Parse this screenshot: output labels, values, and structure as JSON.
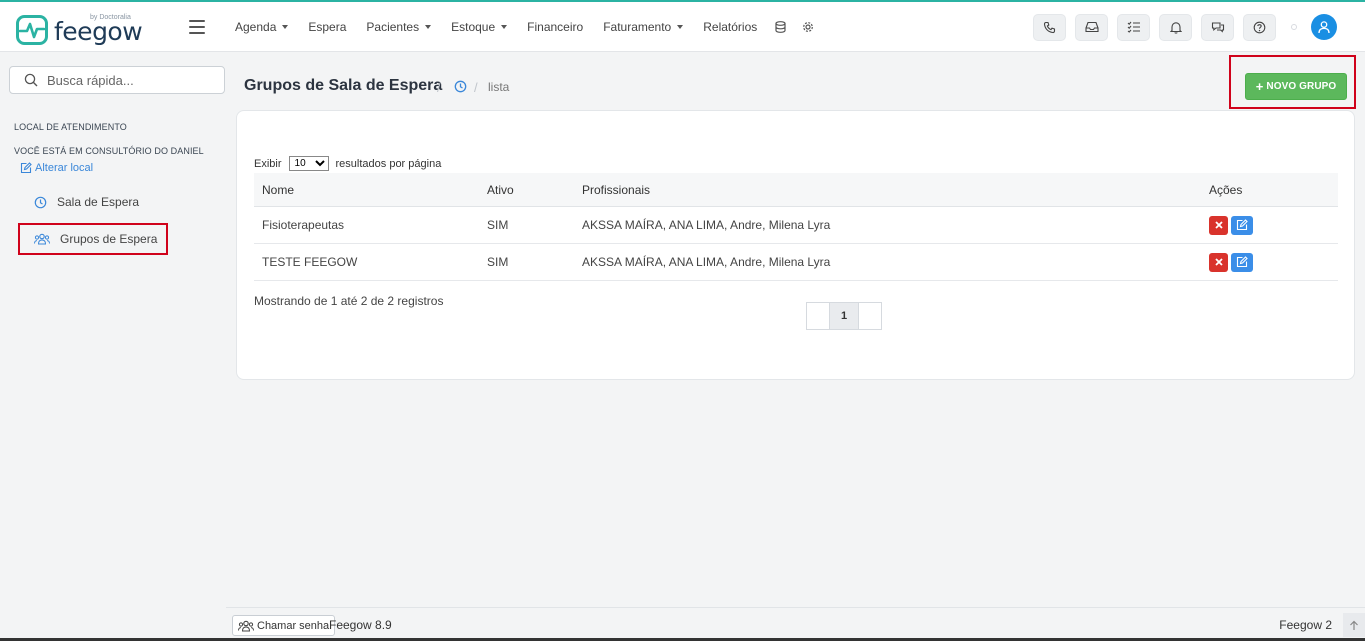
{
  "app": {
    "logo_text": "feegow",
    "logo_sub": "by Doctoralia"
  },
  "nav": {
    "items": [
      {
        "label": "Agenda",
        "dropdown": true
      },
      {
        "label": "Espera",
        "dropdown": false
      },
      {
        "label": "Pacientes",
        "dropdown": true
      },
      {
        "label": "Estoque",
        "dropdown": true
      },
      {
        "label": "Financeiro",
        "dropdown": false
      },
      {
        "label": "Faturamento",
        "dropdown": true
      },
      {
        "label": "Relatórios",
        "dropdown": false
      }
    ],
    "icons": [
      "database-icon",
      "gear-icon"
    ]
  },
  "toolbar": {
    "buttons": [
      "phone-icon",
      "inbox-icon",
      "checklist-icon",
      "bell-icon",
      "chat-icon",
      "help-icon"
    ],
    "avatar_icon": "user-icon",
    "avatar_color": "#1a8fe3"
  },
  "sidebar": {
    "search_placeholder": "Busca rápida...",
    "location_header": "LOCAL DE ATENDIMENTO",
    "location_current": "VOCÊ ESTÁ EM CONSULTÓRIO DO DANIEL",
    "change_location": "Alterar local",
    "items": [
      {
        "label": "Sala de Espera",
        "icon": "clock-icon",
        "active": false
      },
      {
        "label": "Grupos de Espera",
        "icon": "users-icon",
        "active": true
      }
    ]
  },
  "page": {
    "title": "Grupos de Sala de Espera",
    "breadcrumb_icon": "clock-icon",
    "breadcrumb": "lista",
    "new_button": "NOVO GRUPO",
    "new_button_color": "#5cb85c"
  },
  "table": {
    "length_prefix": "Exibir",
    "length_value": "10",
    "length_options": [
      "10"
    ],
    "length_suffix": "resultados por página",
    "columns": [
      "Nome",
      "Ativo",
      "Profissionais",
      "Ações"
    ],
    "rows": [
      {
        "nome": "Fisioterapeutas",
        "ativo": "SIM",
        "profissionais": "AKSSA MAÍRA, ANA LIMA, Andre, Milena Lyra"
      },
      {
        "nome": "TESTE FEEGOW",
        "ativo": "SIM",
        "profissionais": "AKSSA MAÍRA, ANA LIMA, Andre, Milena Lyra"
      }
    ],
    "info": "Mostrando de 1 até 2 de 2 registros",
    "current_page": "1"
  },
  "footer": {
    "chamar_senha": "Chamar senha",
    "version": "Feegow 8.9",
    "version2": "Feegow 2"
  }
}
